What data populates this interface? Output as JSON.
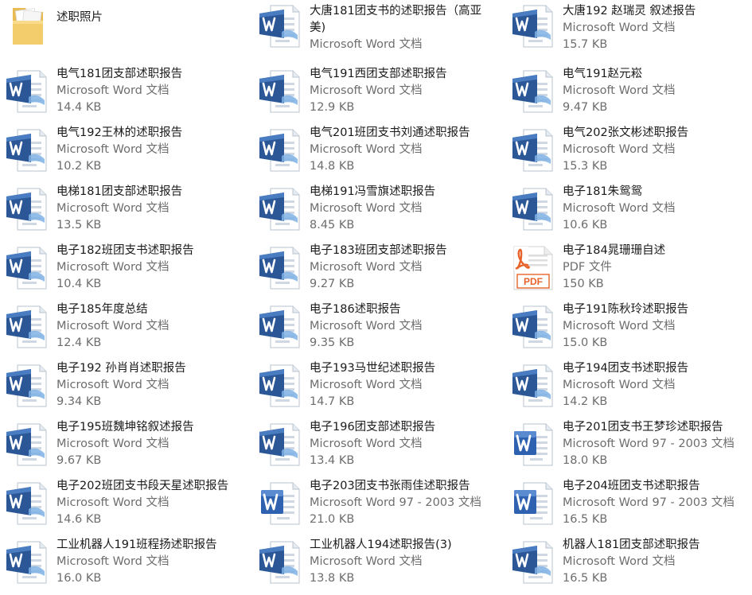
{
  "files": [
    {
      "name": "述职照片",
      "type": "",
      "size": "",
      "icon": "folder-icon"
    },
    {
      "name": "大唐181团支书的述职报告（高亚美)",
      "type": "Microsoft Word 文档",
      "size": "",
      "icon": "word-docx-icon"
    },
    {
      "name": "大唐192  赵瑞灵 叙述报告",
      "type": "Microsoft Word 文档",
      "size": "15.7 KB",
      "icon": "word-docx-icon"
    },
    {
      "name": "电气181团支部述职报告",
      "type": "Microsoft Word 文档",
      "size": "14.4 KB",
      "icon": "word-docx-icon"
    },
    {
      "name": "电气191西团支部述职报告",
      "type": "Microsoft Word 文档",
      "size": "12.9 KB",
      "icon": "word-docx-icon"
    },
    {
      "name": "电气191赵元崧",
      "type": "Microsoft Word 文档",
      "size": "9.47 KB",
      "icon": "word-docx-icon"
    },
    {
      "name": "电气192王林的述职报告",
      "type": "Microsoft Word 文档",
      "size": "10.2 KB",
      "icon": "word-docx-icon"
    },
    {
      "name": "电气201班团支书刘通述职报告",
      "type": "Microsoft Word 文档",
      "size": "14.8 KB",
      "icon": "word-docx-icon"
    },
    {
      "name": "电气202张文彬述职报告",
      "type": "Microsoft Word 文档",
      "size": "15.3 KB",
      "icon": "word-docx-icon"
    },
    {
      "name": "电梯181团支部述职报告",
      "type": "Microsoft Word 文档",
      "size": "13.5 KB",
      "icon": "word-docx-icon"
    },
    {
      "name": "电梯191冯雪旗述职报告",
      "type": "Microsoft Word 文档",
      "size": "8.45 KB",
      "icon": "word-docx-icon"
    },
    {
      "name": "电子181朱鸳鸳",
      "type": "Microsoft Word 文档",
      "size": "10.6 KB",
      "icon": "word-docx-icon"
    },
    {
      "name": "电子182班团支书述职报告",
      "type": "Microsoft Word 文档",
      "size": "10.4 KB",
      "icon": "word-docx-icon"
    },
    {
      "name": "电子183班团支部述职报告",
      "type": "Microsoft Word 文档",
      "size": "9.27 KB",
      "icon": "word-docx-icon"
    },
    {
      "name": "电子184晁珊珊自述",
      "type": "PDF 文件",
      "size": "150 KB",
      "icon": "pdf-icon"
    },
    {
      "name": "电子185年度总结",
      "type": "Microsoft Word 文档",
      "size": "12.4 KB",
      "icon": "word-docx-icon"
    },
    {
      "name": "电子186述职报告",
      "type": "Microsoft Word 文档",
      "size": "9.35 KB",
      "icon": "word-docx-icon"
    },
    {
      "name": "电子191陈秋玲述职报告",
      "type": "Microsoft Word 文档",
      "size": "15.0 KB",
      "icon": "word-docx-icon"
    },
    {
      "name": "电子192 孙肖肖述职报告",
      "type": "Microsoft Word 文档",
      "size": "9.34 KB",
      "icon": "word-docx-icon"
    },
    {
      "name": "电子193马世纪述职报告",
      "type": "Microsoft Word 文档",
      "size": "14.7 KB",
      "icon": "word-docx-icon"
    },
    {
      "name": "电子194团支书述职报告",
      "type": "Microsoft Word 文档",
      "size": "14.2 KB",
      "icon": "word-docx-icon"
    },
    {
      "name": "电子195班魏坤铭叙述报告",
      "type": "Microsoft Word 文档",
      "size": "9.67 KB",
      "icon": "word-docx-icon"
    },
    {
      "name": "电子196团支部述职报告",
      "type": "Microsoft Word 文档",
      "size": "13.4 KB",
      "icon": "word-docx-icon"
    },
    {
      "name": "电子201团支书王梦珍述职报告",
      "type": "Microsoft Word 97 - 2003 文档",
      "size": "18.0 KB",
      "icon": "word-doc-icon"
    },
    {
      "name": "电子202班团支书段天星述职报告",
      "type": "Microsoft Word 文档",
      "size": "14.6 KB",
      "icon": "word-docx-icon"
    },
    {
      "name": "电子203团支书张雨佳述职报告",
      "type": "Microsoft Word 97 - 2003 文档",
      "size": "21.0 KB",
      "icon": "word-doc-icon"
    },
    {
      "name": "电子204班团支书述职报告",
      "type": "Microsoft Word 97 - 2003 文档",
      "size": "16.5 KB",
      "icon": "word-doc-icon"
    },
    {
      "name": "工业机器人191班程扬述职报告",
      "type": "Microsoft Word 文档",
      "size": "16.0 KB",
      "icon": "word-docx-icon"
    },
    {
      "name": "工业机器人194述职报告(3)",
      "type": "Microsoft Word 文档",
      "size": "13.8 KB",
      "icon": "word-docx-icon"
    },
    {
      "name": "机器人181团支部述职报告",
      "type": "Microsoft Word 文档",
      "size": "16.5 KB",
      "icon": "word-docx-icon"
    }
  ],
  "colors": {
    "word_blue": "#2b5797",
    "pdf_orange": "#e8632b",
    "folder_yellow": "#f3cd6b"
  }
}
